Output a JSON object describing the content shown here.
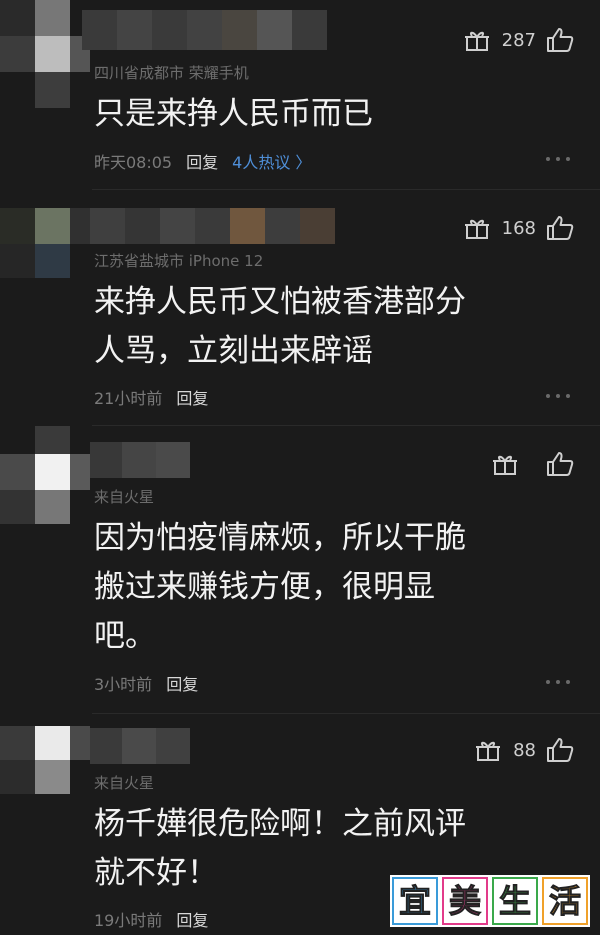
{
  "comments": [
    {
      "location": "四川省成都市  荣耀手机",
      "text": "只是来挣人民币而已",
      "time": "昨天08:05",
      "reply": "回复",
      "hot": "4人热议 〉",
      "likes": "287"
    },
    {
      "location": "江苏省盐城市  iPhone 12",
      "text": "来挣人民币又怕被香港部分\n人骂，立刻出来辟谣",
      "time": "21小时前",
      "reply": "回复",
      "likes": "168"
    },
    {
      "location": "来自火星",
      "text": "因为怕疫情麻烦，所以干脆\n搬过来赚钱方便，很明显\n吧。",
      "time": "3小时前",
      "reply": "回复",
      "likes": ""
    },
    {
      "location": "来自火星",
      "text": "杨千嬅很危险啊！之前风评\n就不好！",
      "time": "19小时前",
      "reply": "回复",
      "likes": "88"
    }
  ],
  "watermark": {
    "chars": [
      "宜",
      "美",
      "生",
      "活"
    ],
    "colors": [
      "#3a9bd9",
      "#e23b8a",
      "#3aa94b",
      "#f0a12a"
    ]
  }
}
